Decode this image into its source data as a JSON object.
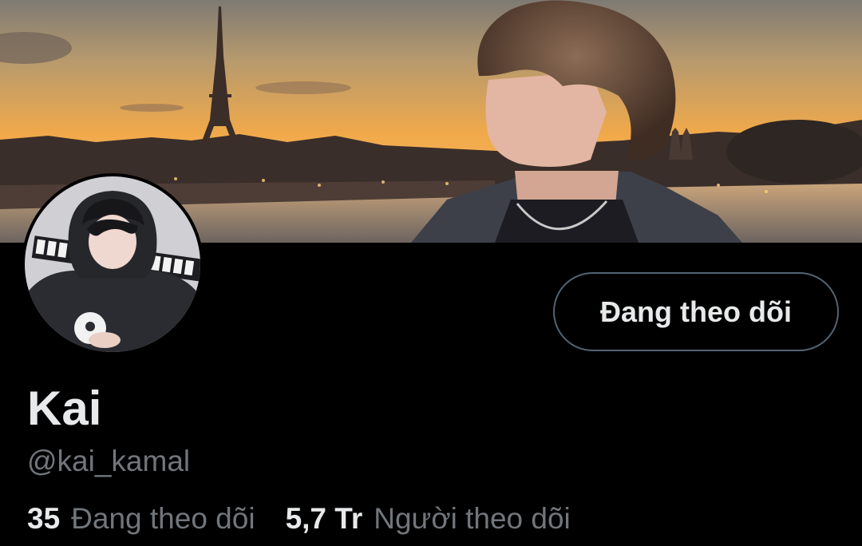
{
  "profile": {
    "display_name": "Kai",
    "handle": "@kai_kamal",
    "follow_button_label": "Đang theo dõi",
    "stats": {
      "following_count": "35",
      "following_label": "Đang theo dõi",
      "followers_count": "5,7 Tr",
      "followers_label": "Người theo dõi"
    }
  },
  "images": {
    "banner": "banner-photo",
    "avatar": "avatar-photo"
  },
  "colors": {
    "background": "#000000",
    "primary_text": "#e7e9ea",
    "secondary_text": "#71767b",
    "button_border": "#536471"
  }
}
